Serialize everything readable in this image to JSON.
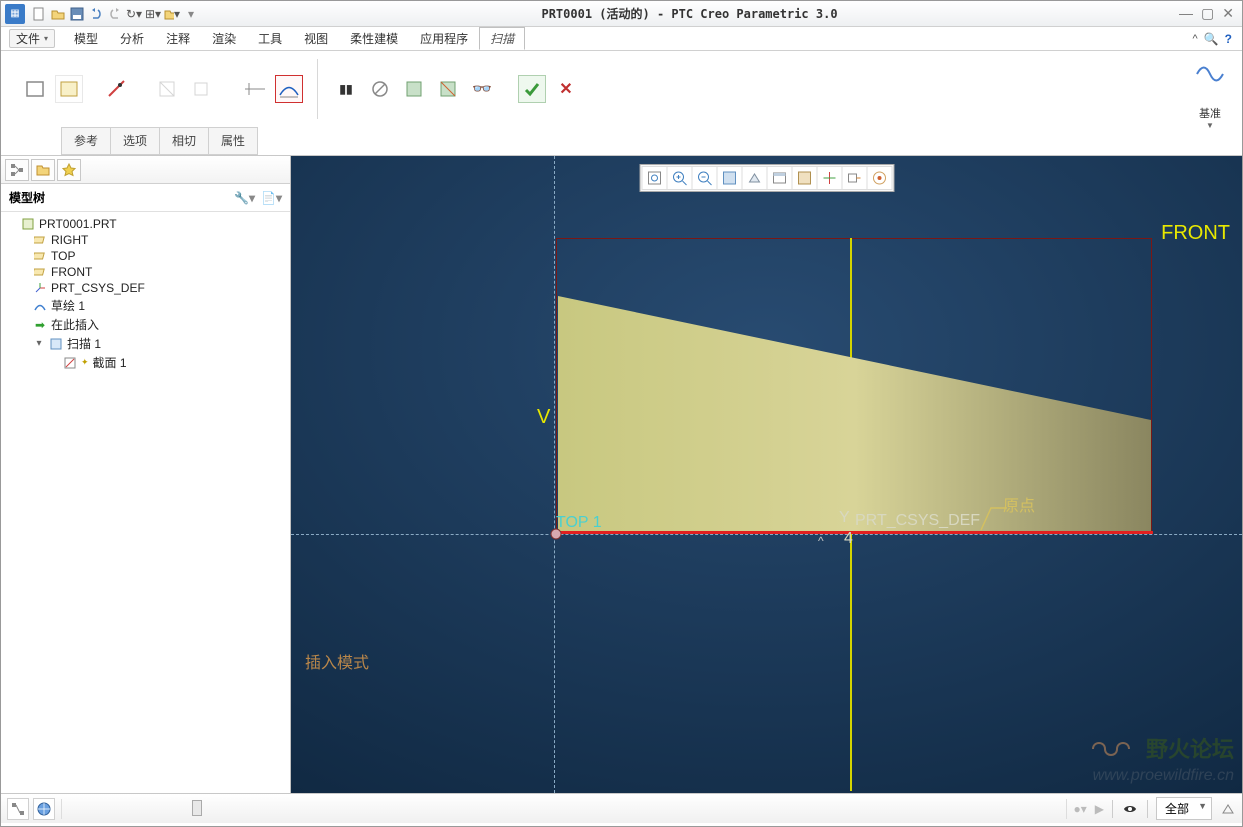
{
  "title": "PRT0001 (活动的) - PTC Creo Parametric 3.0",
  "file_menu": "文件",
  "tabs": [
    "模型",
    "分析",
    "注释",
    "渲染",
    "工具",
    "视图",
    "柔性建模",
    "应用程序",
    "扫描"
  ],
  "active_tab_index": 8,
  "subtabs": [
    "参考",
    "选项",
    "相切",
    "属性"
  ],
  "datum_label": "基准",
  "sidebar": {
    "header": "模型树",
    "root": "PRT0001.PRT",
    "items": [
      {
        "label": "RIGHT",
        "icon": "plane"
      },
      {
        "label": "TOP",
        "icon": "plane"
      },
      {
        "label": "FRONT",
        "icon": "plane"
      },
      {
        "label": "PRT_CSYS_DEF",
        "icon": "csys"
      },
      {
        "label": "草绘 1",
        "icon": "sketch"
      },
      {
        "label": "在此插入",
        "icon": "insert"
      }
    ],
    "sweep": {
      "label": "扫描 1",
      "child": "截面 1"
    }
  },
  "viewport": {
    "front_label": "FRONT",
    "v_label": "V",
    "top_label": "TOP 1",
    "csys_label": "PRT_CSYS_DEF",
    "origin_label": "原点",
    "mode_label": "插入模式",
    "axis_label_y": "Y",
    "axis_num": "4"
  },
  "status": {
    "filter_label": "全部"
  },
  "watermark": {
    "text1": "野火论坛",
    "text2": "www.proewildfire.cn"
  }
}
